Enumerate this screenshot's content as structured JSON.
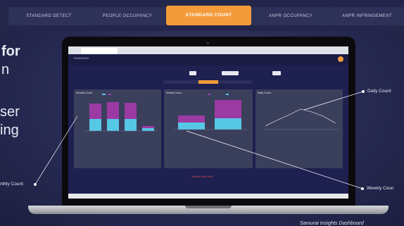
{
  "tabs": [
    {
      "label": "STANDARD DETECT",
      "active": false
    },
    {
      "label": "PEOPLE OCCUPANCY",
      "active": false
    },
    {
      "label": "STANDARD COUNT",
      "active": true
    },
    {
      "label": "ANPR OCCUPANCY",
      "active": false
    },
    {
      "label": "ANPR INFRINGEMENT",
      "active": false
    }
  ],
  "left_text": {
    "line1": "for",
    "line2": "n",
    "line3": "ser",
    "line4": "ing"
  },
  "screen": {
    "logo_text": "SAMURAI",
    "panels": [
      {
        "title": "Monthly Count"
      },
      {
        "title": "Weekly Count"
      },
      {
        "title": "Daily Count"
      }
    ],
    "error_text": "Camera Count Error"
  },
  "callouts": {
    "daily": "Daily Count",
    "weekly": "Weekly Coun",
    "monthly": "nthly Count"
  },
  "caption": "Samurai Insights Dashboard",
  "colors": {
    "accent": "#f39a3a",
    "bar_purple": "#9b3aa3",
    "bar_cyan": "#56c8e6"
  }
}
